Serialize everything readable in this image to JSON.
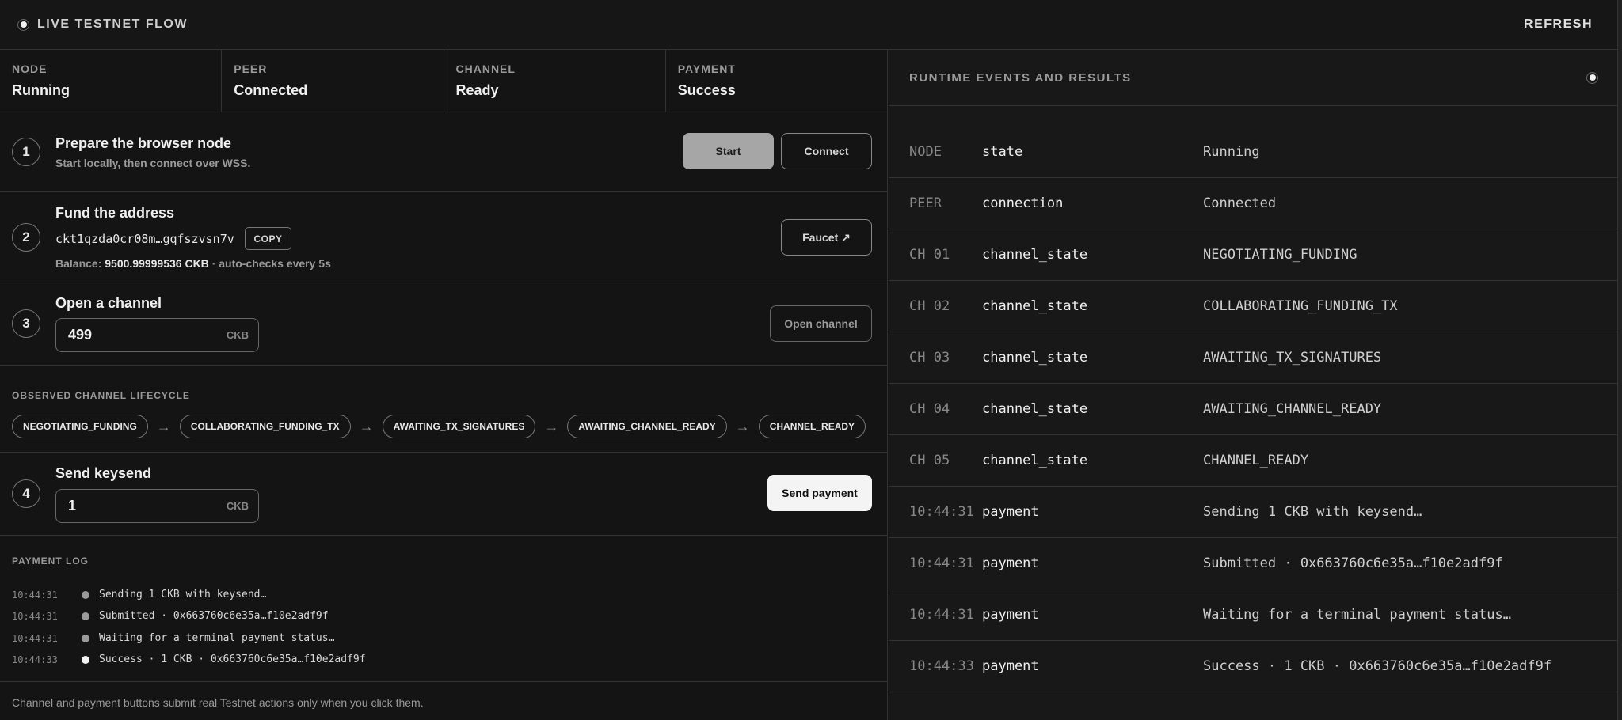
{
  "topbar": {
    "title": "LIVE TESTNET FLOW",
    "refresh": "REFRESH"
  },
  "status": [
    {
      "label": "NODE",
      "value": "Running"
    },
    {
      "label": "PEER",
      "value": "Connected"
    },
    {
      "label": "CHANNEL",
      "value": "Ready"
    },
    {
      "label": "PAYMENT",
      "value": "Success"
    }
  ],
  "step1": {
    "num": "1",
    "title": "Prepare the browser node",
    "sub": "Start locally, then connect over WSS.",
    "start_label": "Start",
    "connect_label": "Connect"
  },
  "step2": {
    "num": "2",
    "title": "Fund the address",
    "address": "ckt1qzda0cr08m…gqfszvsn7v",
    "copy_label": "COPY",
    "balance_prefix": "Balance:",
    "balance_value": "9500.99999536 CKB",
    "balance_suffix": "· auto-checks every 5s",
    "faucet_label": "Faucet ↗"
  },
  "step3": {
    "num": "3",
    "title": "Open a channel",
    "amount": "499",
    "unit": "CKB",
    "open_label": "Open channel"
  },
  "lifecycle": {
    "label": "OBSERVED CHANNEL LIFECYCLE",
    "states": [
      "NEGOTIATING_FUNDING",
      "COLLABORATING_FUNDING_TX",
      "AWAITING_TX_SIGNATURES",
      "AWAITING_CHANNEL_READY",
      "CHANNEL_READY"
    ],
    "arrow": "→"
  },
  "step4": {
    "num": "4",
    "title": "Send keysend",
    "amount": "1",
    "unit": "CKB",
    "send_label": "Send payment"
  },
  "paylog": {
    "label": "PAYMENT LOG",
    "entries": [
      {
        "time": "10:44:31",
        "msg": "Sending 1 CKB with keysend…"
      },
      {
        "time": "10:44:31",
        "msg": "Submitted · 0x663760c6e35a…f10e2adf9f"
      },
      {
        "time": "10:44:31",
        "msg": "Waiting for a terminal payment status…"
      },
      {
        "time": "10:44:33",
        "msg": "Success · 1 CKB · 0x663760c6e35a…f10e2adf9f"
      }
    ]
  },
  "footer": "Channel and payment buttons submit real Testnet actions only when you click them.",
  "events": {
    "title": "RUNTIME EVENTS AND RESULTS",
    "rows": [
      {
        "src": "NODE",
        "key": "state",
        "val": "Running"
      },
      {
        "src": "PEER",
        "key": "connection",
        "val": "Connected"
      },
      {
        "src": "CH 01",
        "key": "channel_state",
        "val": "NEGOTIATING_FUNDING"
      },
      {
        "src": "CH 02",
        "key": "channel_state",
        "val": "COLLABORATING_FUNDING_TX"
      },
      {
        "src": "CH 03",
        "key": "channel_state",
        "val": "AWAITING_TX_SIGNATURES"
      },
      {
        "src": "CH 04",
        "key": "channel_state",
        "val": "AWAITING_CHANNEL_READY"
      },
      {
        "src": "CH 05",
        "key": "channel_state",
        "val": "CHANNEL_READY"
      },
      {
        "src": "10:44:31",
        "key": "payment",
        "val": "Sending 1 CKB with keysend…"
      },
      {
        "src": "10:44:31",
        "key": "payment",
        "val": "Submitted · 0x663760c6e35a…f10e2adf9f"
      },
      {
        "src": "10:44:31",
        "key": "payment",
        "val": "Waiting for a terminal payment status…"
      },
      {
        "src": "10:44:33",
        "key": "payment",
        "val": "Success · 1 CKB · 0x663760c6e35a…f10e2adf9f"
      }
    ]
  }
}
